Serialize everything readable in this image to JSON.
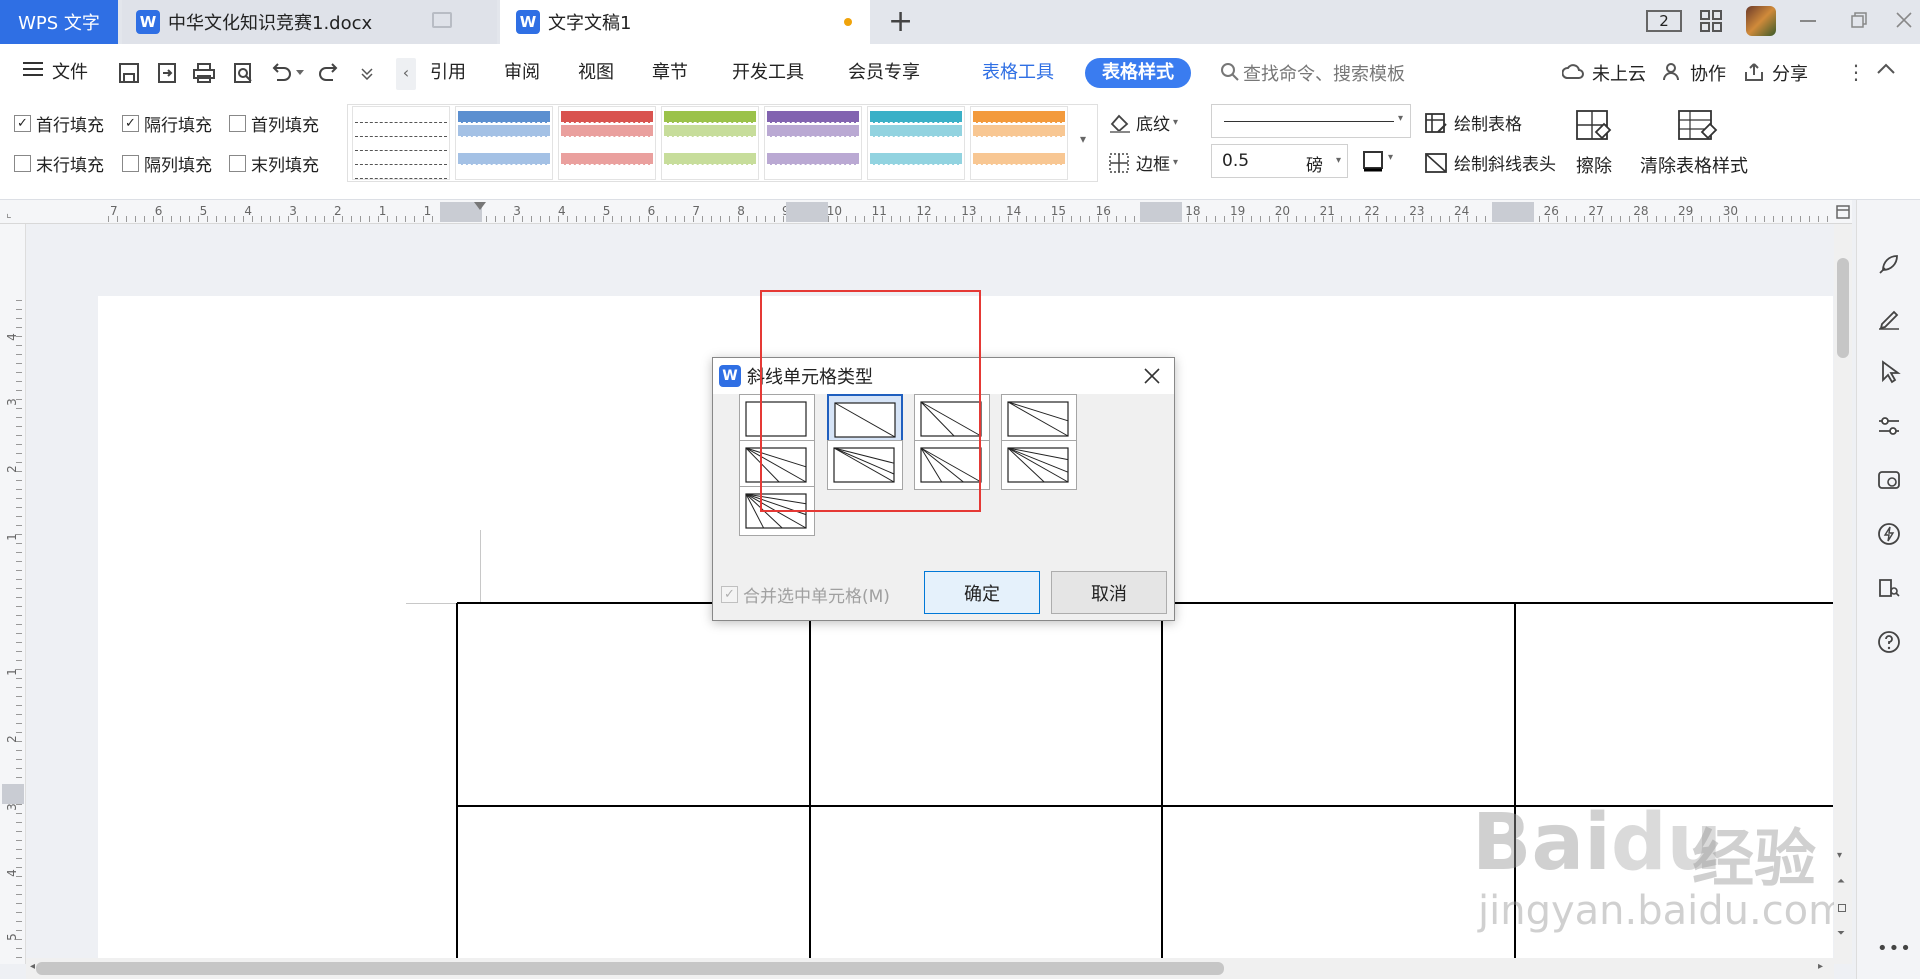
{
  "tabs": {
    "home": "WPS 文字",
    "doc1": "中华文化知识竞赛1.docx",
    "doc2": "文字文稿1",
    "add": "+"
  },
  "window": {
    "page_badge": "2"
  },
  "menu": {
    "file": "文件",
    "items": [
      "引用",
      "审阅",
      "视图",
      "章节",
      "开发工具",
      "会员专享"
    ],
    "table_tools": "表格工具",
    "table_style": "表格样式",
    "search_placeholder": "查找命令、搜索模板",
    "cloud": "未上云",
    "collab": "协作",
    "share": "分享"
  },
  "options": {
    "first_row": "首行填充",
    "alt_row": "隔行填充",
    "first_col": "首列填充",
    "last_row": "末行填充",
    "alt_col": "隔列填充",
    "last_col": "末列填充"
  },
  "gallery_colors": [
    "#ffffff",
    "#5b8fd0",
    "#d9534f",
    "#9bc24a",
    "#8263b0",
    "#3ab0c7",
    "#f39a3c"
  ],
  "ribbon": {
    "shading": "底纹",
    "border": "边框",
    "line_weight": "0.5",
    "unit": "磅",
    "draw_table": "绘制表格",
    "draw_diagonal": "绘制斜线表头",
    "erase": "擦除",
    "clear_style": "清除表格样式"
  },
  "ruler_numbers": [
    "7",
    "6",
    "5",
    "4",
    "3",
    "2",
    "1",
    "1",
    "2",
    "3",
    "4",
    "5",
    "6",
    "7",
    "8",
    "9",
    "10",
    "11",
    "12",
    "13",
    "14",
    "15",
    "16",
    "17",
    "18",
    "19",
    "20",
    "21",
    "22",
    "23",
    "24",
    "25",
    "26",
    "27",
    "28",
    "29",
    "30"
  ],
  "vruler_numbers": [
    "4",
    "3",
    "2",
    "1",
    "1",
    "2",
    "3",
    "4",
    "5"
  ],
  "dialog": {
    "title": "斜线单元格类型",
    "merge_label": "合并选中单元格(M)",
    "ok": "确定",
    "cancel": "取消",
    "selected_index": 1
  },
  "watermark": {
    "brand": "Bai",
    "brand2": "du",
    "cn": "经验",
    "url": "jingyan.baidu.com"
  }
}
